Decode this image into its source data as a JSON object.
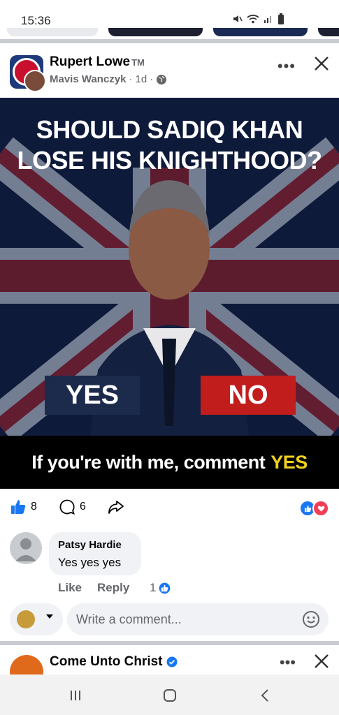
{
  "status_bar": {
    "time": "15:36",
    "icons": [
      "mute-icon",
      "wifi-icon",
      "signal-icon",
      "battery-icon"
    ]
  },
  "post": {
    "group_name": "Rupert Lowe",
    "group_name_suffix": "TM",
    "author": "Mavis Wanczyk",
    "time_ago": "1d",
    "privacy_icon": "globe-icon",
    "more_label": "•••",
    "image": {
      "title_line1": "SHOULD SADIQ KHAN",
      "title_line2": "LOSE HIS KNIGHTHOOD?",
      "yes_label": "YES",
      "no_label": "NO",
      "footer_text": "If you're with me, comment",
      "footer_highlight": "YES"
    },
    "actions": {
      "like_count": "8",
      "comment_count": "6"
    },
    "reactions": [
      "like-icon",
      "love-icon"
    ]
  },
  "comment": {
    "author": "Patsy Hardie",
    "text": "Yes yes yes",
    "like_label": "Like",
    "reply_label": "Reply",
    "like_count": "1"
  },
  "composer": {
    "placeholder": "Write a comment..."
  },
  "next_post": {
    "name": "Come Unto Christ",
    "more_label": "•••",
    "verified": true
  },
  "colors": {
    "facebook_blue": "#1877f2",
    "love_red": "#f33e58",
    "yes_blue": "#1c2a4c",
    "no_red": "#c21d1d",
    "footer_yellow": "#f0d21e",
    "text_primary": "#050505",
    "text_secondary": "#65676b"
  }
}
